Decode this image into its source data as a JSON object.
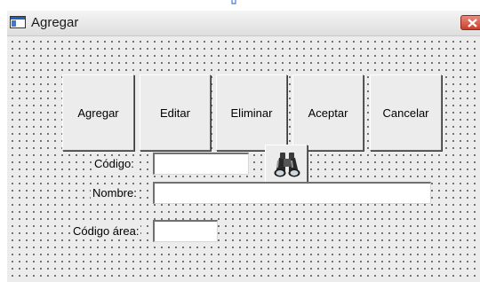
{
  "window": {
    "title": "Agregar"
  },
  "toolbar": {
    "buttons": [
      {
        "label": "Agregar"
      },
      {
        "label": "Editar"
      },
      {
        "label": "Eliminar"
      },
      {
        "label": "Aceptar"
      },
      {
        "label": "Cancelar"
      }
    ]
  },
  "form": {
    "codigo": {
      "label": "Código:",
      "value": ""
    },
    "nombre": {
      "label": "Nombre:",
      "value": ""
    },
    "codigo_area": {
      "label": "Código área:",
      "value": ""
    }
  },
  "colors": {
    "close_button": "#c9412d",
    "form_background": "#ececec"
  },
  "icons": {
    "search": "binoculars-icon",
    "app": "window-icon",
    "close": "close-icon"
  }
}
